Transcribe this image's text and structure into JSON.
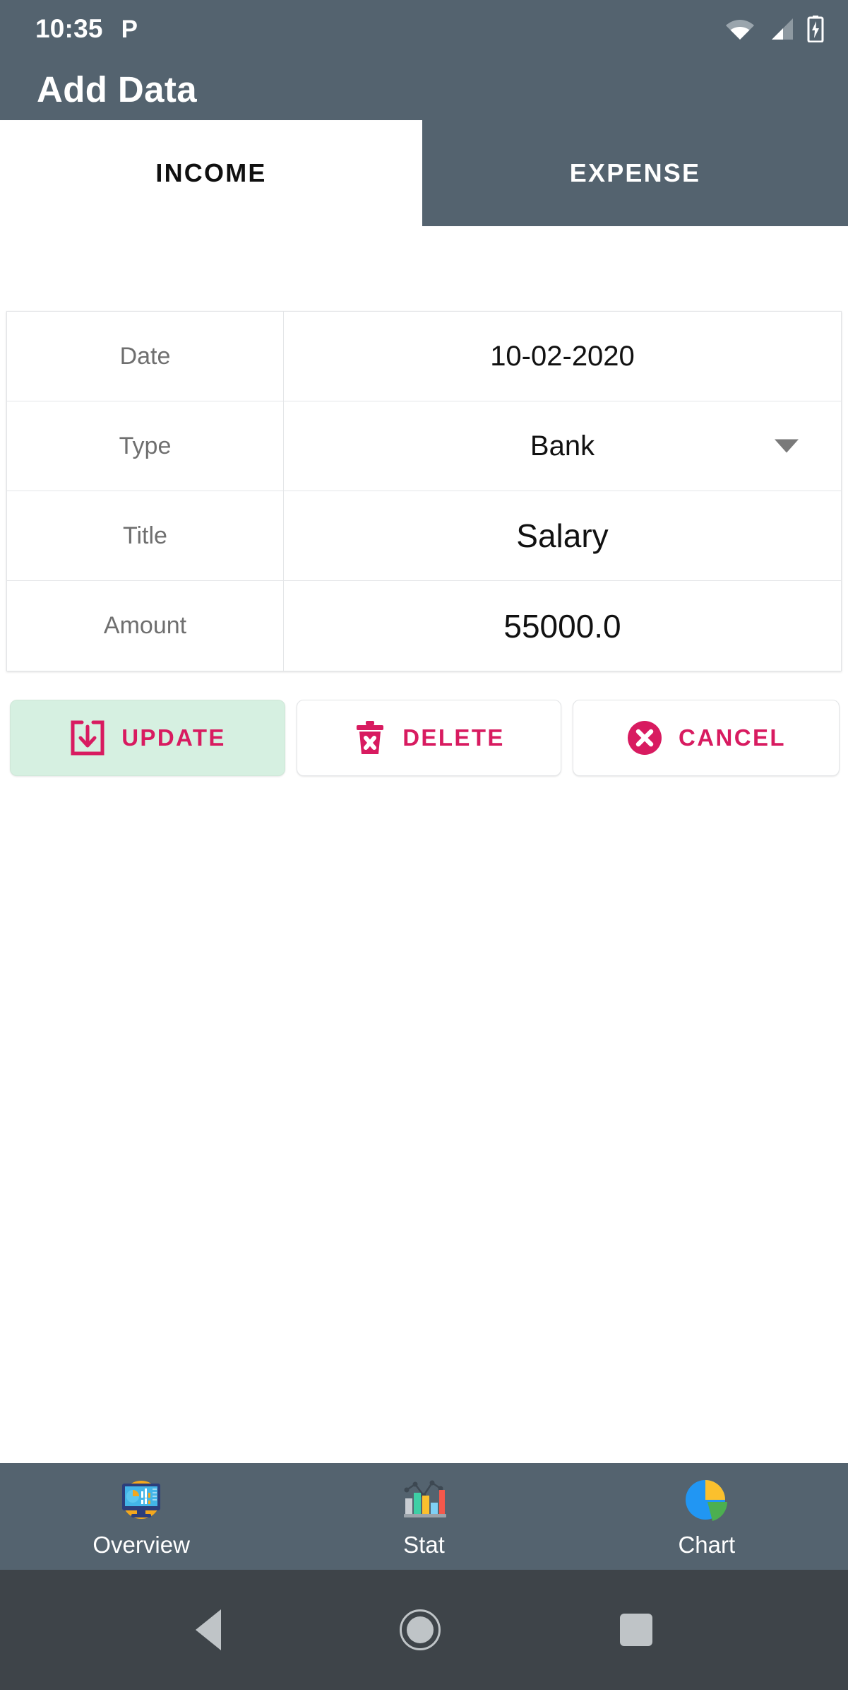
{
  "status_bar": {
    "time": "10:35",
    "p_icon_label": "P",
    "icons": [
      "wifi-icon",
      "cellular-signal-icon",
      "battery-charging-icon"
    ]
  },
  "app_bar": {
    "title": "Add Data"
  },
  "tabs": [
    {
      "label": "INCOME",
      "active": true
    },
    {
      "label": "EXPENSE",
      "active": false
    }
  ],
  "form": {
    "rows": [
      {
        "label": "Date",
        "value": "10-02-2020",
        "control": "text"
      },
      {
        "label": "Type",
        "value": "Bank",
        "control": "dropdown"
      },
      {
        "label": "Title",
        "value": "Salary",
        "control": "text"
      },
      {
        "label": "Amount",
        "value": "55000.0",
        "control": "text"
      }
    ]
  },
  "actions": [
    {
      "label": "UPDATE",
      "icon": "save-download-box-icon",
      "highlighted": true
    },
    {
      "label": "DELETE",
      "icon": "trash-x-icon",
      "highlighted": false
    },
    {
      "label": "CANCEL",
      "icon": "circle-x-icon",
      "highlighted": false
    }
  ],
  "bottom_nav": [
    {
      "label": "Overview",
      "icon": "dashboard-monitor-icon"
    },
    {
      "label": "Stat",
      "icon": "bar-chart-line-icon"
    },
    {
      "label": "Chart",
      "icon": "pie-chart-icon"
    }
  ],
  "android_nav": [
    "back-icon",
    "home-icon",
    "recents-icon"
  ],
  "colors": {
    "app_bar": "#54636F",
    "accent_crimson": "#D81B60",
    "update_bg": "#D6F0E1",
    "label_gray": "#6F6F6F",
    "nav_bar": "#3E4449"
  }
}
